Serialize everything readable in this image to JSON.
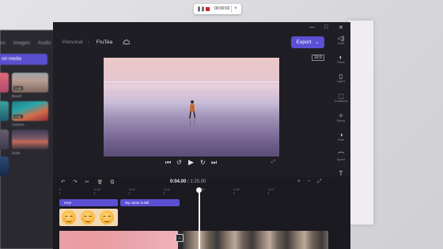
{
  "recording_bar": {
    "pause_icon": "pause-icon",
    "stop_icon": "stop-icon",
    "time": "00:00:02",
    "close": "×"
  },
  "left_panel": {
    "tabs": [
      "os",
      "Images",
      "Audio"
    ],
    "import_label": "ort media",
    "thumbnails": [
      {
        "label": "Beach",
        "duration": "0:16"
      },
      {
        "label": "Canyon",
        "duration": "0:31"
      },
      {
        "label": "Dusk",
        "duration": "0:16"
      }
    ]
  },
  "window": {
    "minimize": "—",
    "maximize": "□",
    "close": "✕"
  },
  "breadcrumb": {
    "parent": "Personal",
    "current": "FruTea",
    "separator": "›"
  },
  "export": {
    "label": "Export",
    "chevron": "⌄"
  },
  "aspect_ratio": "16:9",
  "playback": {
    "skip_back": "⏮",
    "rewind": "↺",
    "play": "▶",
    "forward": "↻",
    "skip_forward": "⏭",
    "fullscreen": "⤢"
  },
  "right_rail": [
    {
      "icon": "audio-icon",
      "glyph": "◁)",
      "label": "Audio"
    },
    {
      "icon": "filters-icon",
      "glyph": "◐",
      "label": "Filters"
    },
    {
      "icon": "layers-icon",
      "glyph": "▯",
      "label": "Layers"
    },
    {
      "icon": "transitions-icon",
      "glyph": "⬚",
      "label": "Transitions"
    },
    {
      "icon": "effects-icon",
      "glyph": "✧",
      "label": "Effects"
    },
    {
      "icon": "fade-icon",
      "glyph": "◑",
      "label": "Fade"
    },
    {
      "icon": "speed-icon",
      "glyph": "⌒",
      "label": "Speed"
    },
    {
      "icon": "text-icon",
      "glyph": "T",
      "label": "Text"
    }
  ],
  "timeline": {
    "tools": [
      "↶",
      "↷",
      "✂",
      "🗑",
      "⧉"
    ],
    "current_time": "0:04.00",
    "total_time": "1:25.00",
    "zoom": [
      "+",
      "−",
      "⤢"
    ],
    "ruler_ticks": [
      "0",
      "0:02",
      "0:03",
      "0:04",
      "0:05",
      "0:06",
      "0:07"
    ],
    "text_clips": [
      {
        "label": "Hey!"
      },
      {
        "label": "My name is Bill"
      }
    ]
  }
}
